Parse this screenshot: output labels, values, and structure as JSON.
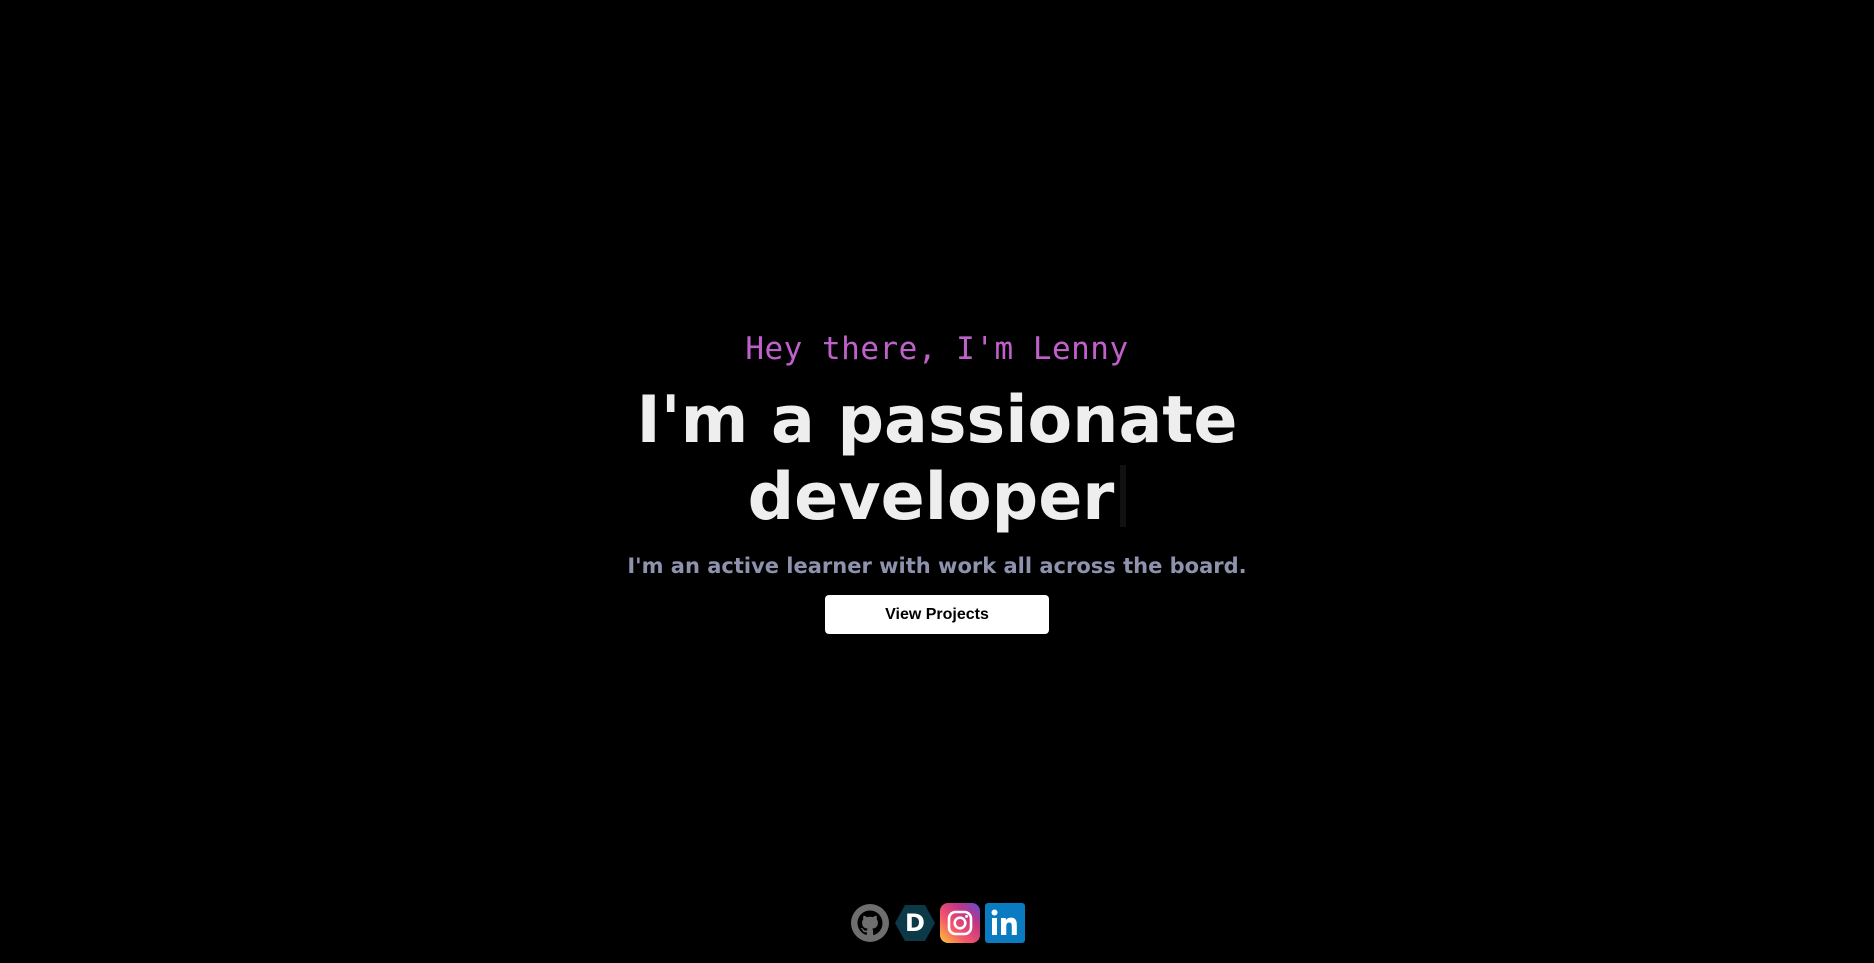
{
  "hero": {
    "greeting": "Hey there, I'm Lenny",
    "headline_line1": "I'm a passionate",
    "headline_line2": "developer",
    "subtitle": "I'm an active learner with work all across the board.",
    "cta_label": "View Projects"
  },
  "colors": {
    "background": "#000000",
    "greeting": "#c061cb",
    "headline": "#eeeeee",
    "subtitle": "#8e92ad",
    "cta_bg": "#ffffff"
  },
  "socials": [
    {
      "icon": "github-icon"
    },
    {
      "icon": "dev-icon",
      "glyph": "D"
    },
    {
      "icon": "instagram-icon"
    },
    {
      "icon": "linkedin-icon",
      "glyph": "in"
    }
  ]
}
